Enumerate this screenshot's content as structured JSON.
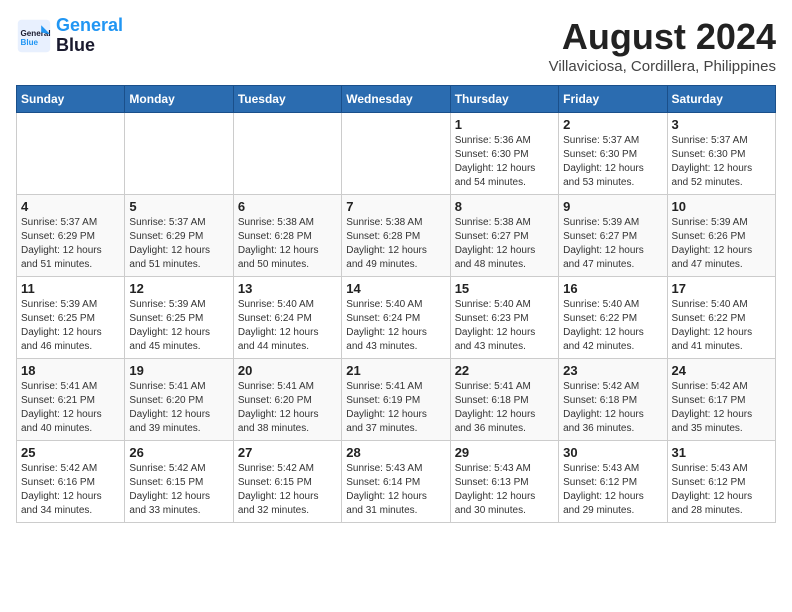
{
  "header": {
    "logo_line1": "General",
    "logo_line2": "Blue",
    "month_year": "August 2024",
    "location": "Villaviciosa, Cordillera, Philippines"
  },
  "calendar": {
    "days_of_week": [
      "Sunday",
      "Monday",
      "Tuesday",
      "Wednesday",
      "Thursday",
      "Friday",
      "Saturday"
    ],
    "weeks": [
      [
        {
          "day": "",
          "info": ""
        },
        {
          "day": "",
          "info": ""
        },
        {
          "day": "",
          "info": ""
        },
        {
          "day": "",
          "info": ""
        },
        {
          "day": "1",
          "info": "Sunrise: 5:36 AM\nSunset: 6:30 PM\nDaylight: 12 hours\nand 54 minutes."
        },
        {
          "day": "2",
          "info": "Sunrise: 5:37 AM\nSunset: 6:30 PM\nDaylight: 12 hours\nand 53 minutes."
        },
        {
          "day": "3",
          "info": "Sunrise: 5:37 AM\nSunset: 6:30 PM\nDaylight: 12 hours\nand 52 minutes."
        }
      ],
      [
        {
          "day": "4",
          "info": "Sunrise: 5:37 AM\nSunset: 6:29 PM\nDaylight: 12 hours\nand 51 minutes."
        },
        {
          "day": "5",
          "info": "Sunrise: 5:37 AM\nSunset: 6:29 PM\nDaylight: 12 hours\nand 51 minutes."
        },
        {
          "day": "6",
          "info": "Sunrise: 5:38 AM\nSunset: 6:28 PM\nDaylight: 12 hours\nand 50 minutes."
        },
        {
          "day": "7",
          "info": "Sunrise: 5:38 AM\nSunset: 6:28 PM\nDaylight: 12 hours\nand 49 minutes."
        },
        {
          "day": "8",
          "info": "Sunrise: 5:38 AM\nSunset: 6:27 PM\nDaylight: 12 hours\nand 48 minutes."
        },
        {
          "day": "9",
          "info": "Sunrise: 5:39 AM\nSunset: 6:27 PM\nDaylight: 12 hours\nand 47 minutes."
        },
        {
          "day": "10",
          "info": "Sunrise: 5:39 AM\nSunset: 6:26 PM\nDaylight: 12 hours\nand 47 minutes."
        }
      ],
      [
        {
          "day": "11",
          "info": "Sunrise: 5:39 AM\nSunset: 6:25 PM\nDaylight: 12 hours\nand 46 minutes."
        },
        {
          "day": "12",
          "info": "Sunrise: 5:39 AM\nSunset: 6:25 PM\nDaylight: 12 hours\nand 45 minutes."
        },
        {
          "day": "13",
          "info": "Sunrise: 5:40 AM\nSunset: 6:24 PM\nDaylight: 12 hours\nand 44 minutes."
        },
        {
          "day": "14",
          "info": "Sunrise: 5:40 AM\nSunset: 6:24 PM\nDaylight: 12 hours\nand 43 minutes."
        },
        {
          "day": "15",
          "info": "Sunrise: 5:40 AM\nSunset: 6:23 PM\nDaylight: 12 hours\nand 43 minutes."
        },
        {
          "day": "16",
          "info": "Sunrise: 5:40 AM\nSunset: 6:22 PM\nDaylight: 12 hours\nand 42 minutes."
        },
        {
          "day": "17",
          "info": "Sunrise: 5:40 AM\nSunset: 6:22 PM\nDaylight: 12 hours\nand 41 minutes."
        }
      ],
      [
        {
          "day": "18",
          "info": "Sunrise: 5:41 AM\nSunset: 6:21 PM\nDaylight: 12 hours\nand 40 minutes."
        },
        {
          "day": "19",
          "info": "Sunrise: 5:41 AM\nSunset: 6:20 PM\nDaylight: 12 hours\nand 39 minutes."
        },
        {
          "day": "20",
          "info": "Sunrise: 5:41 AM\nSunset: 6:20 PM\nDaylight: 12 hours\nand 38 minutes."
        },
        {
          "day": "21",
          "info": "Sunrise: 5:41 AM\nSunset: 6:19 PM\nDaylight: 12 hours\nand 37 minutes."
        },
        {
          "day": "22",
          "info": "Sunrise: 5:41 AM\nSunset: 6:18 PM\nDaylight: 12 hours\nand 36 minutes."
        },
        {
          "day": "23",
          "info": "Sunrise: 5:42 AM\nSunset: 6:18 PM\nDaylight: 12 hours\nand 36 minutes."
        },
        {
          "day": "24",
          "info": "Sunrise: 5:42 AM\nSunset: 6:17 PM\nDaylight: 12 hours\nand 35 minutes."
        }
      ],
      [
        {
          "day": "25",
          "info": "Sunrise: 5:42 AM\nSunset: 6:16 PM\nDaylight: 12 hours\nand 34 minutes."
        },
        {
          "day": "26",
          "info": "Sunrise: 5:42 AM\nSunset: 6:15 PM\nDaylight: 12 hours\nand 33 minutes."
        },
        {
          "day": "27",
          "info": "Sunrise: 5:42 AM\nSunset: 6:15 PM\nDaylight: 12 hours\nand 32 minutes."
        },
        {
          "day": "28",
          "info": "Sunrise: 5:43 AM\nSunset: 6:14 PM\nDaylight: 12 hours\nand 31 minutes."
        },
        {
          "day": "29",
          "info": "Sunrise: 5:43 AM\nSunset: 6:13 PM\nDaylight: 12 hours\nand 30 minutes."
        },
        {
          "day": "30",
          "info": "Sunrise: 5:43 AM\nSunset: 6:12 PM\nDaylight: 12 hours\nand 29 minutes."
        },
        {
          "day": "31",
          "info": "Sunrise: 5:43 AM\nSunset: 6:12 PM\nDaylight: 12 hours\nand 28 minutes."
        }
      ]
    ]
  }
}
